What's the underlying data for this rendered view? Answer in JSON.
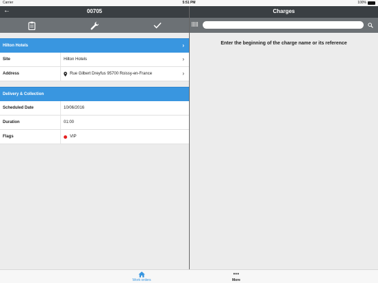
{
  "status_bar": {
    "carrier": "Carrier",
    "time": "5:51 PM",
    "battery": "100%"
  },
  "left_pane": {
    "title": "00705",
    "toolbar": {
      "icons": [
        "clipboard-icon",
        "wrench-icon",
        "checkmark-icon"
      ]
    },
    "client_section": {
      "label": "Hilton Hotels"
    },
    "client_rows": [
      {
        "label": "Site",
        "value": "Hilton Hotels"
      },
      {
        "label": "Address",
        "value": "Rue Gilbert Dreyfus 95700 Roissy-en-France"
      }
    ],
    "delivery_section": {
      "label": "Delivery & Collection"
    },
    "delivery_rows": [
      {
        "label": "Scheduled Date",
        "value": "10/06/2016"
      },
      {
        "label": "Duration",
        "value": "01:00"
      },
      {
        "label": "Flags",
        "value": "VIP",
        "flag_color": "#e51f1f"
      }
    ]
  },
  "right_pane": {
    "title": "Charges",
    "search": {
      "value": "",
      "placeholder": ""
    },
    "hint": "Enter the beginning of the charge name or its reference"
  },
  "tab_bar": {
    "tabs": [
      {
        "label": "Work orders",
        "icon": "home-icon",
        "active": true
      },
      {
        "label": "More",
        "icon": "more-dots-icon",
        "active": false
      }
    ]
  },
  "colors": {
    "accent": "#3996e0",
    "header": "#3a3f43",
    "toolbar": "#6c7175"
  }
}
